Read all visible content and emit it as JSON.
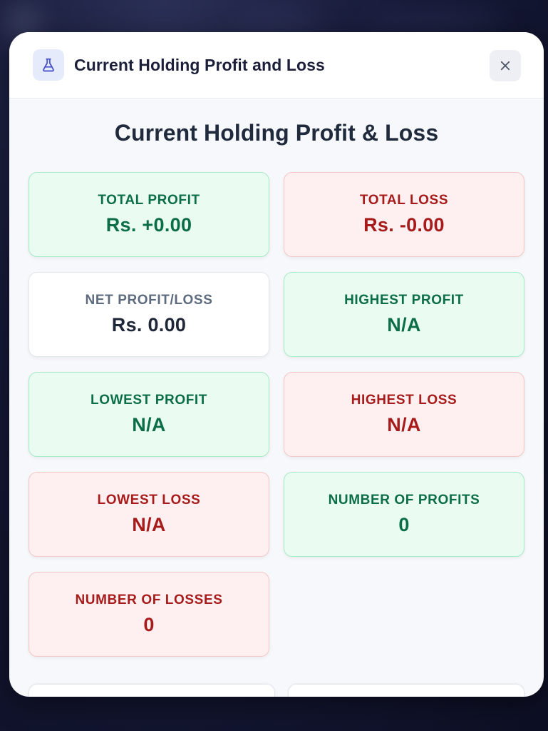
{
  "modal": {
    "header_title": "Current Holding Profit and Loss",
    "header_icon": "flask-icon",
    "close_icon": "close-icon"
  },
  "section": {
    "title": "Current Holding Profit & Loss"
  },
  "colors": {
    "profit": "#0b6e47",
    "loss": "#a81b1b",
    "neutral": "#1e2637"
  },
  "cards": [
    {
      "label": "TOTAL PROFIT",
      "value": "Rs. +0.00",
      "tone": "green"
    },
    {
      "label": "TOTAL LOSS",
      "value": "Rs. -0.00",
      "tone": "red"
    },
    {
      "label": "NET PROFIT/LOSS",
      "value": "Rs. 0.00",
      "tone": "neutral"
    },
    {
      "label": "HIGHEST PROFIT",
      "value": "N/A",
      "tone": "green"
    },
    {
      "label": "LOWEST PROFIT",
      "value": "N/A",
      "tone": "green"
    },
    {
      "label": "HIGHEST LOSS",
      "value": "N/A",
      "tone": "red"
    },
    {
      "label": "LOWEST LOSS",
      "value": "N/A",
      "tone": "red"
    },
    {
      "label": "NUMBER OF PROFITS",
      "value": "0",
      "tone": "green"
    },
    {
      "label": "NUMBER OF LOSSES",
      "value": "0",
      "tone": "red"
    }
  ]
}
